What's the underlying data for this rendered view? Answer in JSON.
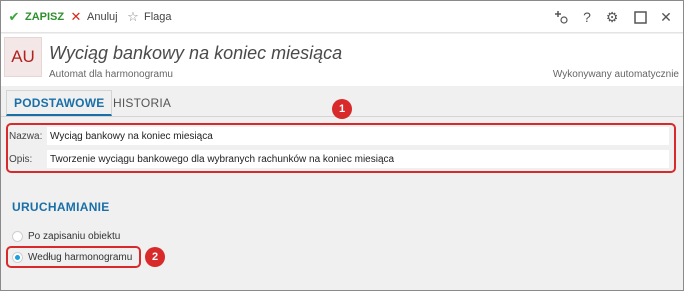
{
  "toolbar": {
    "save_label": "ZAPISZ",
    "cancel_label": "Anuluj",
    "flag_label": "Flaga",
    "save_icon": "✔",
    "cancel_icon": "✕",
    "flag_icon": "☆",
    "add_icon": "+",
    "help_icon": "?",
    "settings_icon": "⚙",
    "maximize_icon": "☐",
    "close_icon": "✕"
  },
  "header": {
    "badge": "AU",
    "title": "Wyciąg bankowy na koniec miesiąca",
    "subtitle": "Automat dla harmonogramu",
    "mode": "Wykonywany automatycznie"
  },
  "tabs": [
    {
      "label": "PODSTAWOWE",
      "active": true
    },
    {
      "label": "HISTORIA",
      "active": false
    }
  ],
  "fields": {
    "name_label": "Nazwa:",
    "name_value": "Wyciąg bankowy na koniec miesiąca",
    "desc_label": "Opis:",
    "desc_value": "Tworzenie wyciągu bankowego dla wybranych rachunków na koniec miesiąca"
  },
  "launch": {
    "title": "URUCHAMIANIE",
    "options": [
      {
        "label": "Po zapisaniu obiektu",
        "selected": false
      },
      {
        "label": "Według harmonogramu",
        "selected": true
      }
    ]
  },
  "callouts": [
    "1",
    "2"
  ],
  "colors": {
    "accent": "#1a6fa8",
    "highlight": "#d82a2a",
    "save": "#3aa53a",
    "badge_text": "#b0231f"
  }
}
